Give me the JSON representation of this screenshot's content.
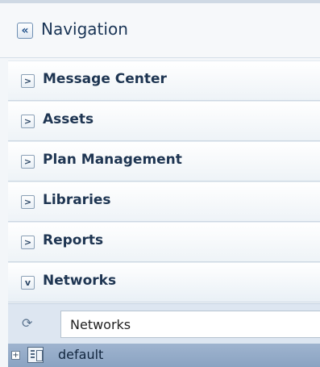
{
  "header": {
    "title": "Navigation",
    "collapse_glyph": "«"
  },
  "panels": [
    {
      "label": "Message Center",
      "state": "collapsed",
      "icon": "chevron-right-icon",
      "glyph": ">"
    },
    {
      "label": "Assets",
      "state": "collapsed",
      "icon": "chevron-right-icon",
      "glyph": ">"
    },
    {
      "label": "Plan Management",
      "state": "collapsed",
      "icon": "chevron-right-icon",
      "glyph": ">"
    },
    {
      "label": "Libraries",
      "state": "collapsed",
      "icon": "chevron-right-icon",
      "glyph": ">"
    },
    {
      "label": "Reports",
      "state": "collapsed",
      "icon": "chevron-right-icon",
      "glyph": ">"
    },
    {
      "label": "Networks",
      "state": "expanded",
      "icon": "chevron-down-icon",
      "glyph": "v"
    }
  ],
  "networks_panel": {
    "refresh_glyph": "⟳",
    "select": {
      "value": "Networks",
      "arrow_glyph": "▾"
    },
    "tree": [
      {
        "label": "default",
        "expander_glyph": "+",
        "icon": "network-grid-icon"
      }
    ]
  },
  "colors": {
    "header_text": "#1a3556",
    "panel_text": "#1e3552",
    "selected_row": "#9fb4cf"
  }
}
